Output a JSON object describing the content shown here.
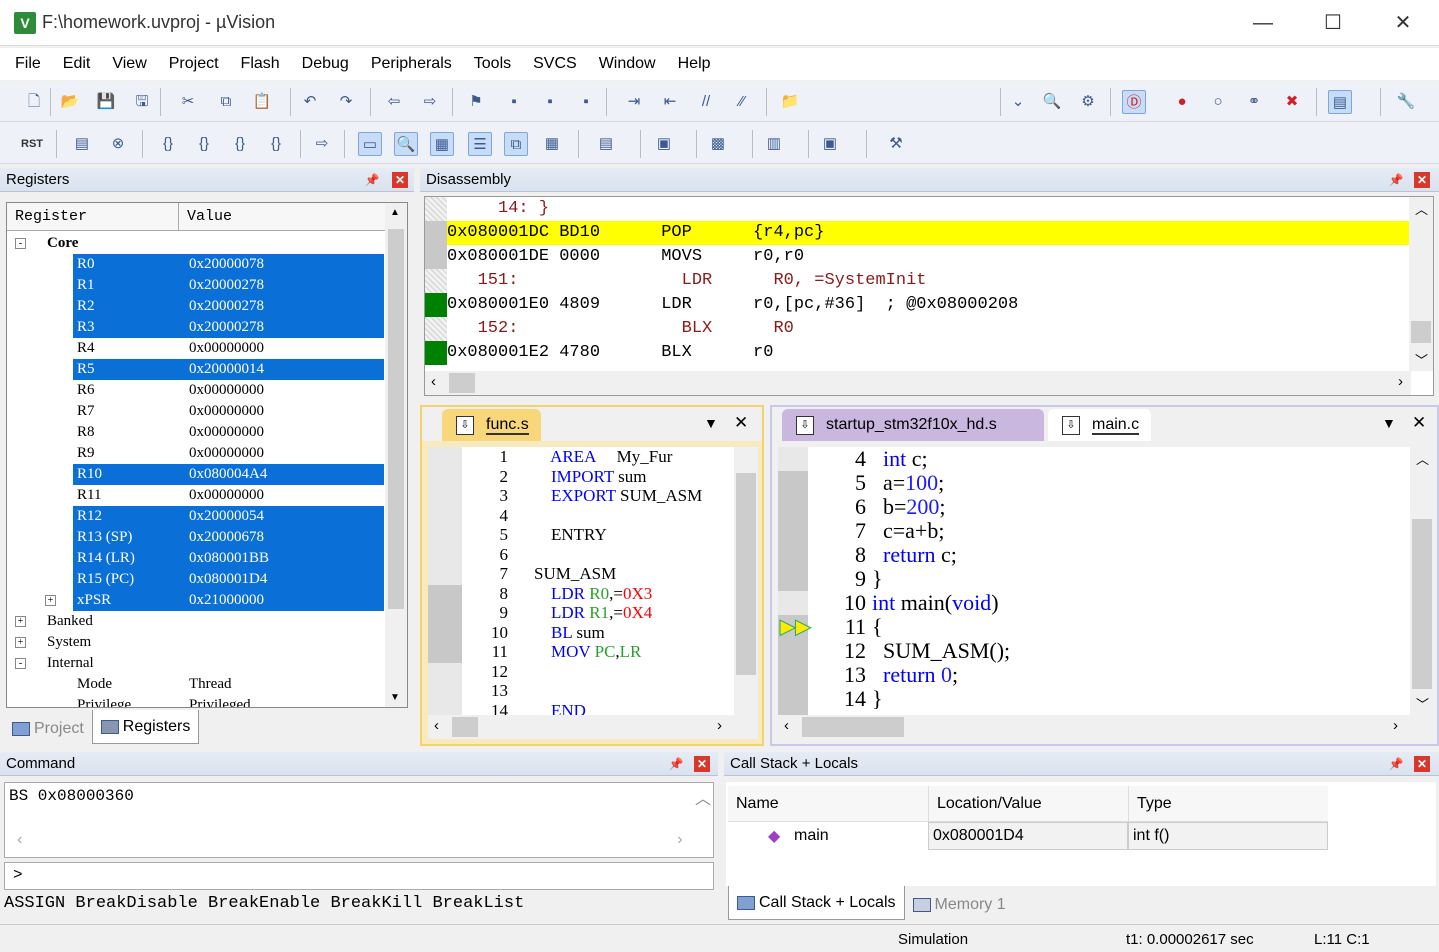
{
  "window": {
    "title": "F:\\homework.uvproj - µVision",
    "app_icon": "uvision-logo"
  },
  "menu": [
    "File",
    "Edit",
    "View",
    "Project",
    "Flash",
    "Debug",
    "Peripherals",
    "Tools",
    "SVCS",
    "Window",
    "Help"
  ],
  "toolbar1": [
    "new-file",
    "open-file",
    "save",
    "save-all",
    "cut",
    "copy",
    "paste",
    "undo",
    "redo",
    "nav-back",
    "nav-forward",
    "bookmark",
    "bookmark-prev",
    "bookmark-next",
    "bookmark-clear",
    "indent",
    "unindent",
    "comment",
    "uncomment",
    "find-in-files",
    "dropdown",
    "find",
    "incremental-find",
    "debug-session",
    "breakpoint-insert",
    "breakpoint-disable",
    "breakpoint-disable-all",
    "breakpoint-kill-all",
    "window-layout",
    "configure"
  ],
  "toolbar2": [
    "reset",
    "run",
    "stop",
    "step-into",
    "step-over",
    "step-out",
    "run-to-cursor",
    "show-next-statement",
    "command-window",
    "disassembly-window",
    "symbols-window",
    "registers-window",
    "call-stack-window",
    "watch-windows",
    "memory-windows",
    "serial-windows",
    "analysis-windows",
    "trace-windows",
    "system-viewer",
    "toolbox"
  ],
  "registers": {
    "title": "Registers",
    "columns": [
      "Register",
      "Value"
    ],
    "rows": [
      {
        "name": "Core",
        "value": "",
        "level": 0,
        "exp": "-",
        "bold": true
      },
      {
        "name": "R0",
        "value": "0x20000078",
        "level": 2,
        "sel": true
      },
      {
        "name": "R1",
        "value": "0x20000278",
        "level": 2,
        "sel": true
      },
      {
        "name": "R2",
        "value": "0x20000278",
        "level": 2,
        "sel": true
      },
      {
        "name": "R3",
        "value": "0x20000278",
        "level": 2,
        "sel": true
      },
      {
        "name": "R4",
        "value": "0x00000000",
        "level": 2
      },
      {
        "name": "R5",
        "value": "0x20000014",
        "level": 2,
        "sel": true
      },
      {
        "name": "R6",
        "value": "0x00000000",
        "level": 2
      },
      {
        "name": "R7",
        "value": "0x00000000",
        "level": 2
      },
      {
        "name": "R8",
        "value": "0x00000000",
        "level": 2
      },
      {
        "name": "R9",
        "value": "0x00000000",
        "level": 2
      },
      {
        "name": "R10",
        "value": "0x080004A4",
        "level": 2,
        "sel": true
      },
      {
        "name": "R11",
        "value": "0x00000000",
        "level": 2
      },
      {
        "name": "R12",
        "value": "0x20000054",
        "level": 2,
        "sel": true
      },
      {
        "name": "R13 (SP)",
        "value": "0x20000678",
        "level": 2,
        "sel": true
      },
      {
        "name": "R14 (LR)",
        "value": "0x080001BB",
        "level": 2,
        "sel": true
      },
      {
        "name": "R15 (PC)",
        "value": "0x080001D4",
        "level": 2,
        "sel": true
      },
      {
        "name": "xPSR",
        "value": "0x21000000",
        "level": 2,
        "sel": true,
        "exp": "+"
      },
      {
        "name": "Banked",
        "value": "",
        "level": 0,
        "exp": "+"
      },
      {
        "name": "System",
        "value": "",
        "level": 0,
        "exp": "+"
      },
      {
        "name": "Internal",
        "value": "",
        "level": 0,
        "exp": "-"
      },
      {
        "name": "Mode",
        "value": "Thread",
        "level": 2
      },
      {
        "name": "Privilege",
        "value": "Privileged",
        "level": 2
      }
    ],
    "tabs": [
      {
        "label": "Project",
        "active": false
      },
      {
        "label": "Registers",
        "active": true
      }
    ]
  },
  "disassembly": {
    "title": "Disassembly",
    "lines": [
      {
        "text": "     14: }",
        "type": "src",
        "mark": "none"
      },
      {
        "text": "0x080001DC BD10      POP      {r4,pc}",
        "type": "cur",
        "mark": "gray"
      },
      {
        "text": "0x080001DE 0000      MOVS     r0,r0",
        "type": "asm",
        "mark": "gray"
      },
      {
        "text": "   151:                LDR      R0, =SystemInit",
        "type": "src",
        "mark": "none"
      },
      {
        "text": "0x080001E0 4809      LDR      r0,[pc,#36]  ; @0x08000208",
        "type": "asm",
        "mark": "green"
      },
      {
        "text": "   152:                BLX      R0",
        "type": "src",
        "mark": "none"
      },
      {
        "text": "0x080001E2 4780      BLX      r0",
        "type": "asm",
        "mark": "green"
      }
    ]
  },
  "func_editor": {
    "tab": "func.s",
    "lines": [
      [
        [
          "    ",
          ""
        ],
        [
          "AREA",
          "kw"
        ],
        [
          "     My_Fur",
          ""
        ]
      ],
      [
        [
          "    ",
          ""
        ],
        [
          "IMPORT",
          "kw"
        ],
        [
          " sum",
          ""
        ]
      ],
      [
        [
          "    ",
          ""
        ],
        [
          "EXPORT",
          "kw"
        ],
        [
          " SUM_ASM",
          ""
        ]
      ],
      [],
      [
        [
          "    ENTRY",
          ""
        ]
      ],
      [],
      [
        [
          "SUM_ASM",
          ""
        ]
      ],
      [
        [
          "    ",
          ""
        ],
        [
          "LDR",
          "kw"
        ],
        [
          " ",
          ""
        ],
        [
          "R0",
          "rg"
        ],
        [
          ",=",
          ""
        ],
        [
          "0X3",
          "nm"
        ]
      ],
      [
        [
          "    ",
          ""
        ],
        [
          "LDR",
          "kw"
        ],
        [
          " ",
          ""
        ],
        [
          "R1",
          "rg"
        ],
        [
          ",=",
          ""
        ],
        [
          "0X4",
          "nm"
        ]
      ],
      [
        [
          "    ",
          ""
        ],
        [
          "BL",
          "kw"
        ],
        [
          " sum",
          ""
        ]
      ],
      [
        [
          "    ",
          ""
        ],
        [
          "MOV",
          "kw"
        ],
        [
          " ",
          ""
        ],
        [
          "PC",
          "rg"
        ],
        [
          ",",
          ""
        ],
        [
          "LR",
          "rg"
        ]
      ],
      [],
      [],
      [
        [
          "    ",
          ""
        ],
        [
          "END",
          "kw"
        ]
      ]
    ],
    "first_line": 1
  },
  "main_editor": {
    "tabs": [
      {
        "label": "startup_stm32f10x_hd.s",
        "active": false
      },
      {
        "label": "main.c",
        "active": true
      }
    ],
    "first_line": 4,
    "lines": [
      [
        [
          "  ",
          ""
        ],
        [
          "int",
          "kw"
        ],
        [
          " c;",
          ""
        ]
      ],
      [
        [
          "  a=",
          ""
        ],
        [
          "100",
          "num"
        ],
        [
          ";",
          ""
        ]
      ],
      [
        [
          "  b=",
          ""
        ],
        [
          "200",
          "num"
        ],
        [
          ";",
          ""
        ]
      ],
      [
        [
          "  c=a+b;",
          ""
        ]
      ],
      [
        [
          "  ",
          ""
        ],
        [
          "return",
          "kw"
        ],
        [
          " c;",
          ""
        ]
      ],
      [
        [
          "}",
          ""
        ]
      ],
      [
        [
          "int",
          "kw"
        ],
        [
          " main(",
          ""
        ],
        [
          "void",
          "kw"
        ],
        [
          ")",
          ""
        ]
      ],
      [
        [
          "{",
          ""
        ]
      ],
      [
        [
          "  SUM_ASM();",
          ""
        ]
      ],
      [
        [
          "  ",
          ""
        ],
        [
          "return",
          "kw"
        ],
        [
          " ",
          ""
        ],
        [
          "0",
          "num"
        ],
        [
          ";",
          ""
        ]
      ],
      [
        [
          "}",
          ""
        ]
      ]
    ]
  },
  "command": {
    "title": "Command",
    "output": "BS 0x08000360",
    "prompt": ">",
    "hint": "ASSIGN BreakDisable BreakEnable BreakKill BreakList"
  },
  "callstack": {
    "title": "Call Stack + Locals",
    "columns": [
      "Name",
      "Location/Value",
      "Type"
    ],
    "rows": [
      {
        "name": "main",
        "location": "0x080001D4",
        "type": "int f()"
      }
    ],
    "tabs": [
      {
        "label": "Call Stack + Locals",
        "active": true
      },
      {
        "label": "Memory 1",
        "active": false
      }
    ]
  },
  "status": {
    "mode": "Simulation",
    "time": "t1: 0.00002617 sec",
    "cursor": "L:11 C:1"
  },
  "colors": {
    "selection": "#0a6fd6",
    "current_line": "#ffff00",
    "exec_mark": "#008000",
    "editor_border": "#f4d36b"
  }
}
